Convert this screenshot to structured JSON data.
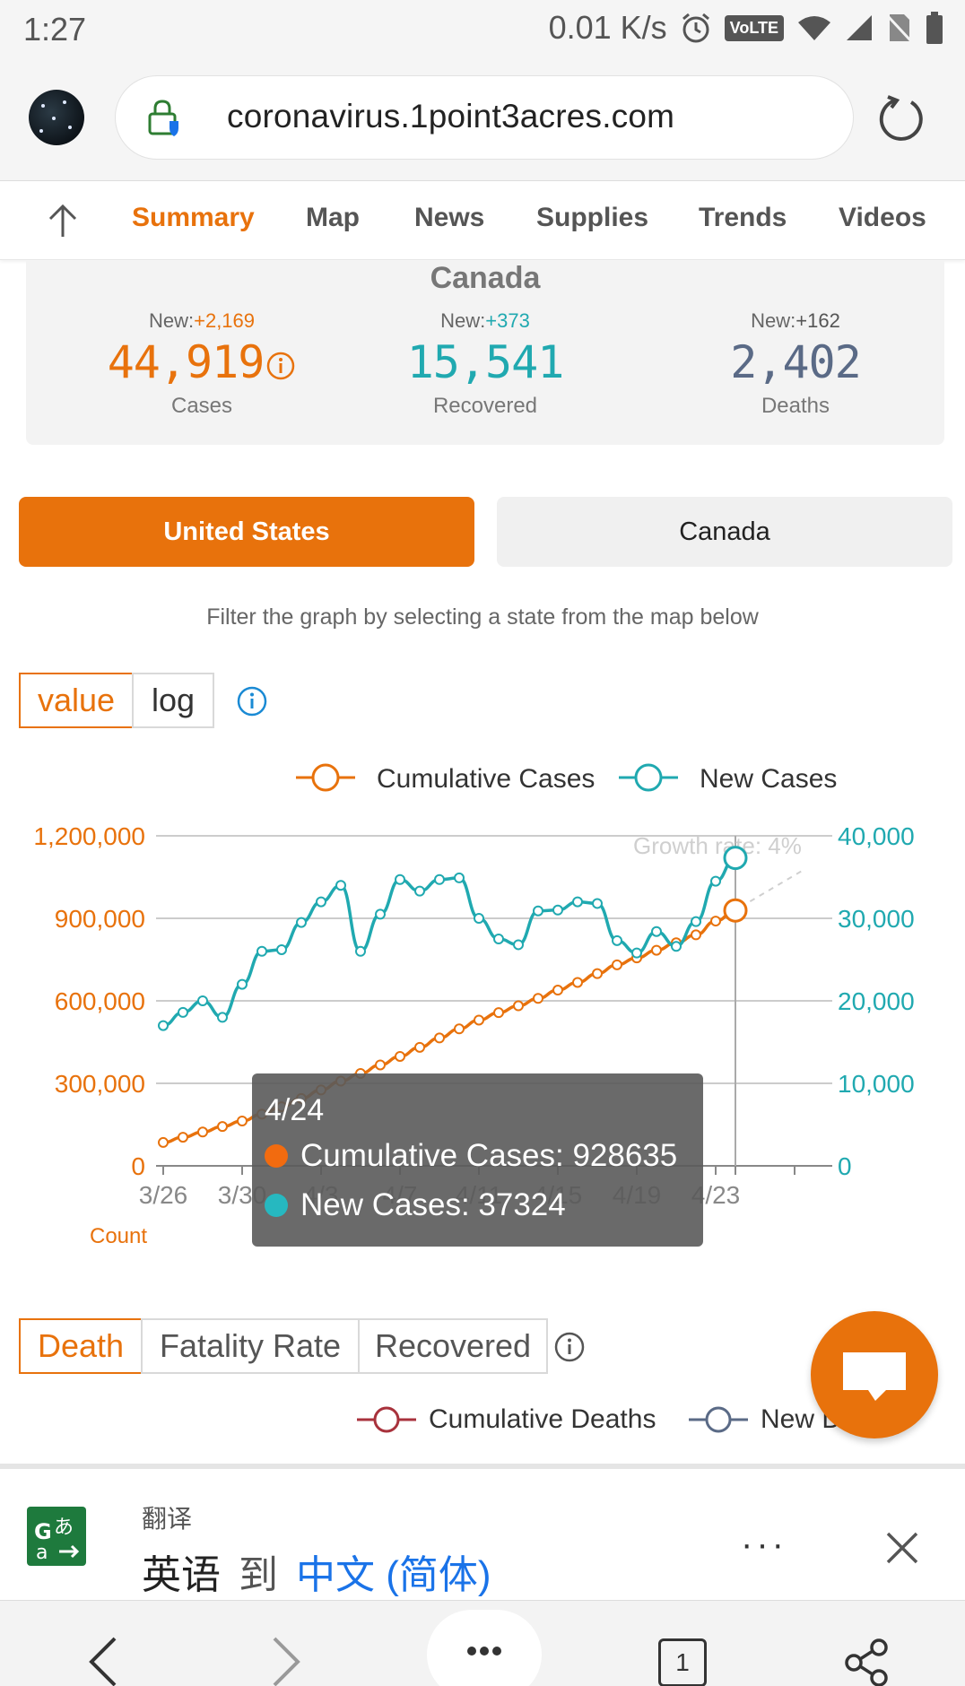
{
  "status_bar": {
    "time": "1:27",
    "speed": "0.01 K/s",
    "volte": "VoLTE"
  },
  "browser": {
    "url": "coronavirus.1point3acres.com"
  },
  "nav": {
    "tabs": [
      "Summary",
      "Map",
      "News",
      "Supplies",
      "Trends",
      "Videos"
    ],
    "active": "Summary"
  },
  "summary": {
    "country": "Canada",
    "cases": {
      "new_label": "New:",
      "new_value": "+2,169",
      "value": "44,919",
      "label": "Cases"
    },
    "recovered": {
      "new_label": "New:",
      "new_value": "+373",
      "value": "15,541",
      "label": "Recovered"
    },
    "deaths": {
      "new_label": "New:",
      "new_value": "+162",
      "value": "2,402",
      "label": "Deaths"
    }
  },
  "country_toggle": {
    "options": [
      "United States",
      "Canada"
    ],
    "selected": "United States"
  },
  "filter_hint": "Filter the graph by selecting a state from the map below",
  "scale_toggle": {
    "options": [
      "value",
      "log"
    ],
    "selected": "value"
  },
  "chart_data": {
    "type": "line",
    "legend": [
      "Cumulative Cases",
      "New Cases"
    ],
    "legend_position": "top-right",
    "grid": true,
    "x_tick_labels": [
      "3/26",
      "3/30",
      "4/3",
      "4/7",
      "4/11",
      "4/15",
      "4/19",
      "4/23"
    ],
    "y_left_ticks": [
      "0",
      "300,000",
      "600,000",
      "900,000",
      "1,200,000"
    ],
    "y_right_ticks": [
      "0",
      "10,000",
      "20,000",
      "30,000",
      "40,000"
    ],
    "y_left_label": "Count",
    "ylim_left": [
      0,
      1200000
    ],
    "ylim_right": [
      0,
      40000
    ],
    "annotation": "Growth rate: 4%",
    "x": [
      "3/26",
      "3/27",
      "3/28",
      "3/29",
      "3/30",
      "3/31",
      "4/1",
      "4/2",
      "4/3",
      "4/4",
      "4/5",
      "4/6",
      "4/7",
      "4/8",
      "4/9",
      "4/10",
      "4/11",
      "4/12",
      "4/13",
      "4/14",
      "4/15",
      "4/16",
      "4/17",
      "4/18",
      "4/19",
      "4/20",
      "4/21",
      "4/22",
      "4/23",
      "4/24"
    ],
    "series": [
      {
        "name": "Cumulative Cases",
        "axis": "left",
        "color": "#e8720c",
        "values": [
          85000,
          104000,
          123000,
          143000,
          163000,
          188000,
          215000,
          245000,
          276000,
          308000,
          336000,
          367000,
          398000,
          431000,
          465000,
          498000,
          530000,
          557000,
          582000,
          609000,
          639000,
          667000,
          699000,
          731000,
          756000,
          784000,
          811000,
          840000,
          890000,
          928635
        ]
      },
      {
        "name": "New Cases",
        "axis": "right",
        "color": "#20a9b0",
        "values": [
          17000,
          18600,
          20000,
          18000,
          22000,
          26000,
          26200,
          29500,
          32000,
          34000,
          26000,
          30500,
          34700,
          33300,
          34700,
          34900,
          30000,
          27500,
          26800,
          30900,
          31000,
          32000,
          31800,
          27300,
          25800,
          28400,
          26600,
          29600,
          34500,
          37324
        ]
      }
    ],
    "tooltip": {
      "date": "4/24",
      "lines": [
        {
          "label": "Cumulative Cases: 928635",
          "color": "#e8720c"
        },
        {
          "label": "New Cases: 37324",
          "color": "#20a9b0"
        }
      ]
    }
  },
  "metric_toggle": {
    "options": [
      "Death",
      "Fatality Rate",
      "Recovered"
    ],
    "selected": "Death"
  },
  "legend2": [
    "Cumulative Deaths",
    "New D"
  ],
  "translate": {
    "label": "翻译",
    "source": "英语",
    "to": "到",
    "target": "中文 (简体)",
    "more": "···"
  },
  "bottom_nav": {
    "tab_count": "1"
  }
}
